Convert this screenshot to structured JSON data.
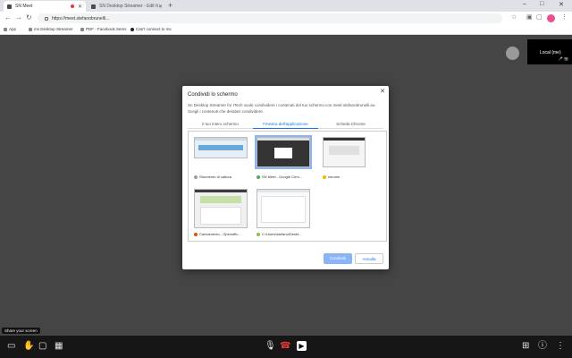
{
  "browser": {
    "tabs": [
      {
        "label": "SN Meet",
        "active": true
      },
      {
        "label": "SN Desktop Streamer - Edit Item",
        "active": false
      }
    ],
    "new_tab_glyph": "+",
    "window_controls": [
      "–",
      "□",
      "✕"
    ],
    "url": "https://meet.stefanobrunelli...",
    "bookmarks": [
      "App",
      "ms Desktop Streamer",
      "PDF - Facebook Sems",
      "Can't connect to ms"
    ]
  },
  "meeting": {
    "local_label": "Local (me)",
    "local_icons": "🎤 📷",
    "tooltip": "Share your screen"
  },
  "dialog": {
    "title": "Condividi lo schermo",
    "description": "Sn Desktop Streamer for ITech vuole condividere i contenuti del tuo schermo con meet.stefanobrunelli.eu. Scegli i contenuti che desideri condividere.",
    "tabs": [
      "Il tuo intero schermo",
      "Finestra dell'applicazione",
      "Scheda Chrome"
    ],
    "windows": [
      {
        "label": "Strumento di cattura",
        "icon_color": "#9e9e9e"
      },
      {
        "label": "SN Meet - Google Chro...",
        "icon_color": "#4caf50"
      },
      {
        "label": "chrome",
        "icon_color": "#f4b400"
      },
      {
        "label": "Caricamento - Openoffic...",
        "icon_color": "#e65100"
      },
      {
        "label": "C:\\Users\\stefano\\Deskt...",
        "icon_color": "#8bc34a"
      }
    ],
    "share_button": "Condividi",
    "cancel_button": "Annulla"
  },
  "colors": {
    "accent": "#1a73e8",
    "share_disabled": "#8ab4f8",
    "hangup": "#e53935",
    "background": "#454545"
  }
}
